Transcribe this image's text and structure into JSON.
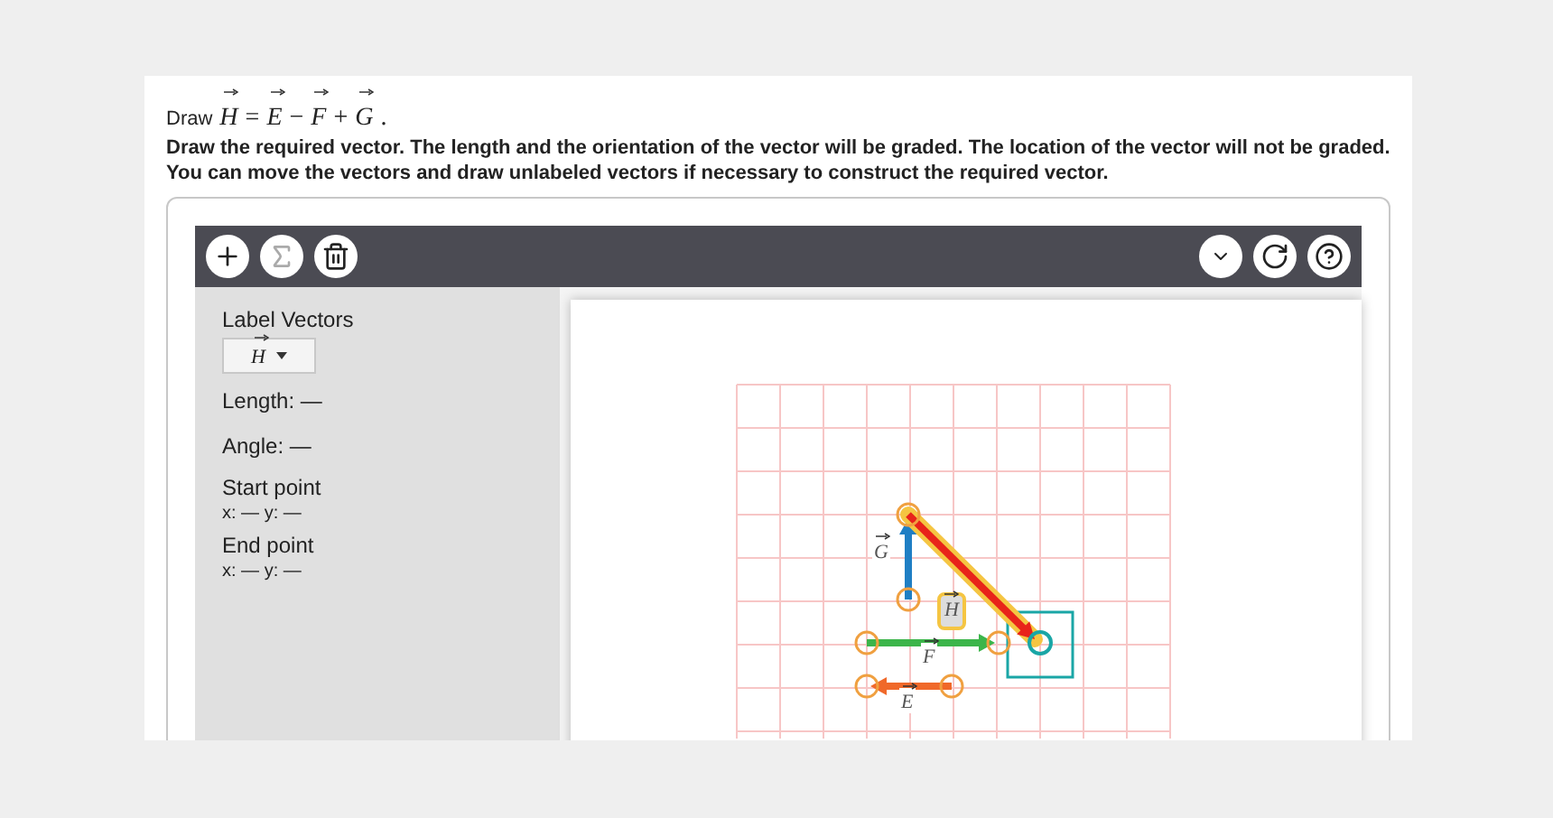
{
  "prompt": {
    "lead": "Draw",
    "formula": [
      {
        "text": "H",
        "vector": true
      },
      {
        "text": "=",
        "vector": false
      },
      {
        "text": "E",
        "vector": true
      },
      {
        "text": "−",
        "vector": false
      },
      {
        "text": "F",
        "vector": true
      },
      {
        "text": "+",
        "vector": false
      },
      {
        "text": "G",
        "vector": true
      },
      {
        "text": ".",
        "vector": false
      }
    ]
  },
  "instructions": "Draw the required vector. The length and the orientation of the vector will be graded. The location of the vector will not be graded. You can move the vectors and draw unlabeled vectors if necessary to construct the required vector.",
  "toolbar": {
    "left": [
      {
        "kind": "add",
        "disabled": false
      },
      {
        "kind": "sum",
        "disabled": true
      },
      {
        "kind": "delete",
        "disabled": false
      }
    ],
    "right": [
      {
        "kind": "dropdown"
      },
      {
        "kind": "reset"
      },
      {
        "kind": "help"
      }
    ]
  },
  "panel": {
    "label_title": "Label Vectors",
    "label_value": "H",
    "length": "Length: —",
    "angle": "Angle: —",
    "start_title": "Start point",
    "start_value": "x: — y: —",
    "end_title": "End point",
    "end_value": "x: — y: —"
  },
  "vectors": [
    {
      "label": "G",
      "color": "#1f7fc4",
      "selected": false
    },
    {
      "label": "H",
      "color": "#e8231a",
      "selected": true
    },
    {
      "label": "F",
      "color": "#3cb54a",
      "selected": false
    },
    {
      "label": "E",
      "color": "#f0692a",
      "selected": false
    }
  ]
}
